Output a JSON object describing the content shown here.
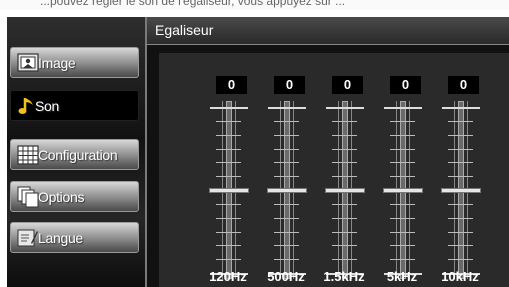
{
  "top_strip_text": "...pouvez régler le son de l'égaliseur, vous appuyez sur ...",
  "header": {
    "title": "Egaliseur"
  },
  "sidebar": {
    "items": [
      {
        "label": "Image",
        "icon": "picture-icon",
        "active": false
      },
      {
        "label": "Son",
        "icon": "music-note-icon",
        "active": true
      },
      {
        "label": "Configuration",
        "icon": "grid-icon",
        "active": false
      },
      {
        "label": "Options",
        "icon": "layers-icon",
        "active": false
      },
      {
        "label": "Langue",
        "icon": "language-icon",
        "active": false
      }
    ]
  },
  "equalizer": {
    "bands": [
      {
        "freq": "120Hz",
        "value": "0",
        "level": 0
      },
      {
        "freq": "500Hz",
        "value": "0",
        "level": 0
      },
      {
        "freq": "1.5kHz",
        "value": "0",
        "level": 0
      },
      {
        "freq": "5kHz",
        "value": "0",
        "level": 0
      },
      {
        "freq": "10kHz",
        "value": "0",
        "level": 0
      }
    ]
  },
  "colors": {
    "background": "#000000",
    "panel": "#2a2a2a",
    "text": "#ffffff",
    "knob": "#e6e6e6"
  }
}
